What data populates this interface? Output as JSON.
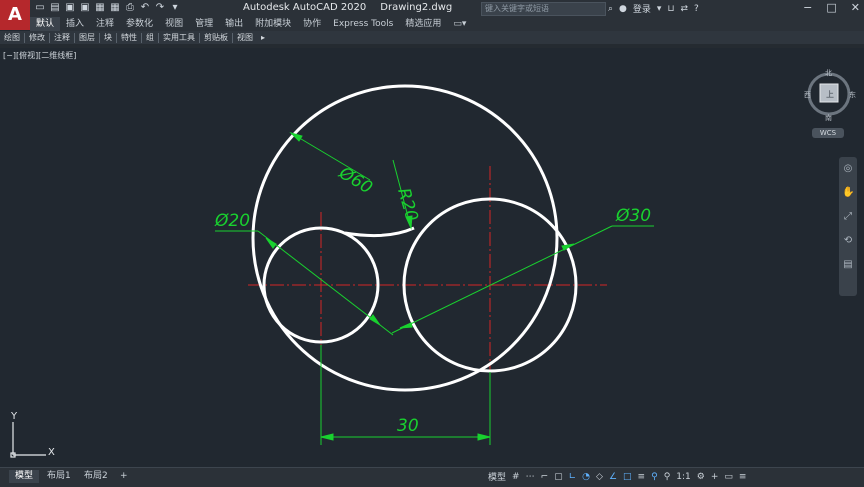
{
  "window": {
    "app_title": "Autodesk AutoCAD 2020",
    "document": "Drawing2.dwg",
    "search_placeholder": "键入关键字或短语",
    "login": "登录"
  },
  "ribbon": {
    "tabs": [
      "默认",
      "插入",
      "注释",
      "参数化",
      "视图",
      "管理",
      "输出",
      "附加模块",
      "协作",
      "Express Tools",
      "精选应用"
    ],
    "active_tab": "默认",
    "panels": [
      "绘图",
      "修改",
      "注释",
      "图层",
      "块",
      "特性",
      "组",
      "实用工具",
      "剪贴板",
      "视图"
    ]
  },
  "viewport": {
    "label": "[−][俯视][二维线框]"
  },
  "viewcube": {
    "north": "北",
    "south": "南",
    "west": "西",
    "east": "东",
    "top": "上",
    "wcs": "WCS"
  },
  "ucs": {
    "x": "X",
    "y": "Y"
  },
  "dimensions": {
    "d60": "Ø60",
    "r20": "R20",
    "d20": "Ø20",
    "d30": "Ø30",
    "linear30": "30"
  },
  "layout_tabs": [
    "模型",
    "布局1",
    "布局2"
  ],
  "status": {
    "model": "模型",
    "scale": "1:1"
  },
  "colors": {
    "background": "#212830",
    "geometry": "#ffffff",
    "dimension": "#19d12f",
    "centerline": "#d42626",
    "app_red": "#b5282c"
  }
}
